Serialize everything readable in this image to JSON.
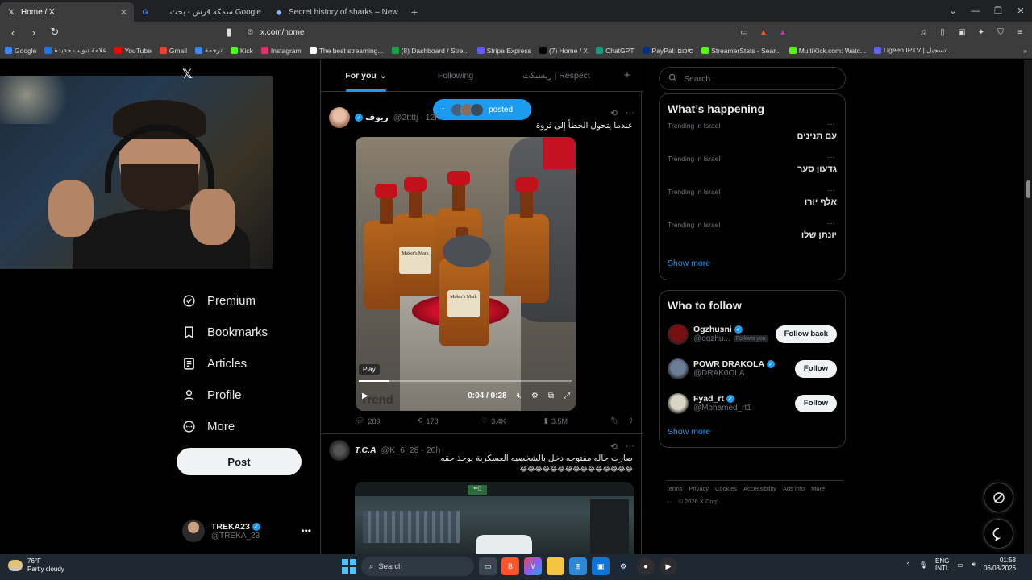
{
  "browser": {
    "tabs": [
      {
        "title": "Home / X",
        "icon": "x-logo-icon",
        "active": true
      },
      {
        "title": "سمكه قرش - بحث Google",
        "icon": "google-icon",
        "active": false
      },
      {
        "title": "Secret history of sharks – News",
        "icon": "news-icon",
        "active": false
      }
    ],
    "url": "x.com/home",
    "bookmarks": [
      {
        "label": "Google",
        "color": "#4285f4"
      },
      {
        "label": "علامة تبويب جديدة",
        "color": "#1877f2"
      },
      {
        "label": "YouTube",
        "color": "#ff0000"
      },
      {
        "label": "Gmail",
        "color": "#ea4335"
      },
      {
        "label": "ترجمة",
        "color": "#4285f4"
      },
      {
        "label": "Kick",
        "color": "#53fc18"
      },
      {
        "label": "Instagram",
        "color": "#e1306c"
      },
      {
        "label": "The best streaming...",
        "color": "#ffffff"
      },
      {
        "label": "(8) Dashboard / Stre...",
        "color": "#16a34a"
      },
      {
        "label": "Stripe Express",
        "color": "#635bff"
      },
      {
        "label": "(7) Home / X",
        "color": "#000000"
      },
      {
        "label": "ChatGPT",
        "color": "#10a37f"
      },
      {
        "label": "PayPal: סיכום",
        "color": "#003087"
      },
      {
        "label": "StreamerStats - Sear...",
        "color": "#53fc18"
      },
      {
        "label": "MultiKick.com: Watc...",
        "color": "#53fc18"
      },
      {
        "label": "Ugeen IPTV | تسجيل...",
        "color": "#6366f1"
      }
    ]
  },
  "sidebar": {
    "items": [
      {
        "label": "Premium",
        "icon": "premium-icon"
      },
      {
        "label": "Bookmarks",
        "icon": "bookmark-icon"
      },
      {
        "label": "Articles",
        "icon": "articles-icon"
      },
      {
        "label": "Profile",
        "icon": "profile-icon"
      },
      {
        "label": "More",
        "icon": "more-circle-icon"
      }
    ],
    "post_label": "Post",
    "account": {
      "name": "TREKA23",
      "handle": "@TREKA_23"
    }
  },
  "feed": {
    "tabs": [
      "For you",
      "Following",
      "ريسبكت | Respect"
    ],
    "posted_pill": "posted",
    "tweet1": {
      "name": "ريوف",
      "handle": "@2ttttj · 12h",
      "text": "عندما يتحول الخطأ إلى ثروة",
      "video_play_tip": "Play",
      "video_time": "0:04 / 0:28",
      "video_progress": 0.143,
      "bottle_label": "Maker's Mark",
      "watermark": "Trend",
      "replies": "289",
      "reposts": "178",
      "likes": "3.4K",
      "views": "3.5M"
    },
    "tweet2": {
      "name": "T.C.A",
      "handle": "@K_6_28 · 20h",
      "text_line1": "صارت حاله مفتوحه دخل بالشخصيه العسكرية يوخذ حقه",
      "text_line2": "😂😂😂😂😂😂😂😂😂😂😂😂😂😂😂"
    }
  },
  "right": {
    "search_placeholder": "Search",
    "whats_happening_title": "What’s happening",
    "trends": [
      {
        "context": "Trending in Israel",
        "topic": "עם תנינים"
      },
      {
        "context": "Trending in Israel",
        "topic": "גדעון סער"
      },
      {
        "context": "Trending in Israel",
        "topic": "אלף יורו"
      },
      {
        "context": "Trending in Israel",
        "topic": "יונתן שלו"
      }
    ],
    "show_more": "Show more",
    "who_to_follow_title": "Who to follow",
    "follow": [
      {
        "name": "Ogzhusni",
        "handle": "@ogzhu...",
        "badge": "Follows you",
        "button": "Follow back",
        "color": "#7a0f12"
      },
      {
        "name": "POWR DRAKOLA",
        "handle": "@DRAK0OLA",
        "badge": "",
        "button": "Follow",
        "color": "#6b7d99"
      },
      {
        "name": "Fyad_rt",
        "handle": "@Mohamed_rt1",
        "badge": "",
        "button": "Follow",
        "color": "#d9d4c3"
      }
    ],
    "footer": [
      "Terms",
      "Privacy",
      "Cookies",
      "Accessibility",
      "Ads info",
      "More ···",
      "© 2026 X Corp."
    ]
  },
  "taskbar": {
    "weather_temp": "76°F",
    "weather_desc": "Partly cloudy",
    "search_label": "Search",
    "lang_line1": "ENG",
    "lang_line2": "INTL",
    "time": "01:58",
    "date": "06/08/2026"
  }
}
